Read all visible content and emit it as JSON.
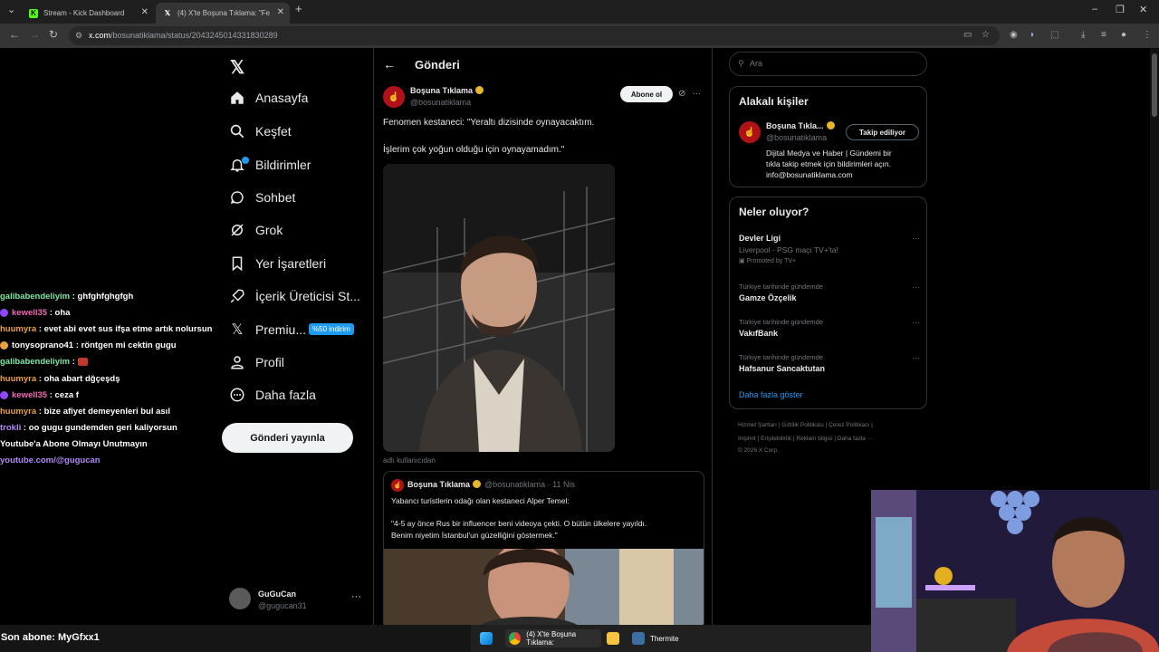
{
  "browser": {
    "tabs": [
      {
        "title": "Stream - Kick Dashboard",
        "active": false
      },
      {
        "title": "(4) X'te Boşuna Tıklama: \"Fe",
        "active": true
      }
    ],
    "new_tab": "+",
    "url_host": "x.com",
    "url_path": "/bosunatiklama/status/2043245014331830289",
    "window_controls": [
      "–",
      "❐",
      "✕"
    ]
  },
  "nav": {
    "items": [
      {
        "label": "Anasayfa",
        "icon": "home-icon"
      },
      {
        "label": "Keşfet",
        "icon": "search-icon"
      },
      {
        "label": "Bildirimler",
        "icon": "bell-icon"
      },
      {
        "label": "Sohbet",
        "icon": "chat-icon"
      },
      {
        "label": "Grok",
        "icon": "grok-icon"
      },
      {
        "label": "Yer İşaretleri",
        "icon": "bookmark-icon"
      },
      {
        "label": "İçerik Üreticisi St...",
        "icon": "rocket-icon"
      },
      {
        "label": "Premiu...",
        "icon": "x-icon"
      },
      {
        "label": "Profil",
        "icon": "user-icon"
      },
      {
        "label": "Daha fazla",
        "icon": "more-circle-icon"
      }
    ],
    "premium_badge": "%50 indirim",
    "post_button": "Gönderi yayınla",
    "account": {
      "name": "GuGuCan",
      "handle": "@gugucan31"
    }
  },
  "post": {
    "header_title": "Gönderi",
    "author_name": "Boşuna Tıklama",
    "author_handle": "@bosunatiklama",
    "subscribe_button": "Abone ol",
    "text_line1": "Fenomen kestaneci: \"Yeraltı dizisinde oynayacaktım.",
    "text_line2": "İşlerim çok yoğun olduğu için oynayamadım.\"",
    "media_caption": "adlı kullanıcıdan",
    "quote": {
      "author_name": "Boşuna Tıklama",
      "handle_date": "@bosunatiklama · 11 Nis",
      "line1": "Yabancı turistlerin odağı olan kestaneci Alper Temel:",
      "line2": "\"4-5 ay önce Rus bir influencer beni videoya çekti. O bütün ülkelere yayıldı.",
      "line3": "Benim niyetim İstanbul'un güzelliğini göstermek.\""
    }
  },
  "sidebar": {
    "search_placeholder": "Ara",
    "related": {
      "title": "Alakalı kişiler",
      "name": "Boşuna Tıkla...",
      "handle": "@bosunatiklama",
      "follow_button": "Takip ediliyor",
      "bio1": "Dijital Medya ve Haber | Gündemi bir",
      "bio2": "tıkla takip etmek için bildirimleri açın.",
      "bio3": "info@bosunatiklama.com"
    },
    "trends": {
      "title": "Neler oluyor?",
      "items": [
        {
          "context": "",
          "name": "Devler Ligi",
          "sub": "Liverpool - PSG maçı TV+'ta!",
          "promo": "Promoted by TV+"
        },
        {
          "context": "Türkiye tarihinde gündemde",
          "name": "Gamze Özçelik",
          "sub": "",
          "promo": ""
        },
        {
          "context": "Türkiye tarihinde gündemde",
          "name": "VakıfBank",
          "sub": "",
          "promo": ""
        },
        {
          "context": "Türkiye tarihinde gündemde",
          "name": "Hafsanur Sancaktutan",
          "sub": "",
          "promo": ""
        }
      ],
      "show_more": "Daha fazla göster"
    },
    "footer_line1": "Hizmet Şartları   |   Gizlilik Politikası   |   Çerez Politikası   |",
    "footer_line2": "Imprint   |   Erişilebilirlik   |   Reklam bilgisi   |   Daha fazla ···",
    "footer_line3": "© 2026 X Corp."
  },
  "chat": {
    "lines": [
      {
        "user": "galibabendeliyim",
        "msg": "ghfghfghgfgh",
        "color": "green",
        "badge": ""
      },
      {
        "user": "kewell35",
        "msg": "oha",
        "color": "pink",
        "badge": "#9146ff"
      },
      {
        "user": "huumyra",
        "msg": "evet abi evet sus ifşa etme artık nolursun",
        "color": "orange",
        "badge": ""
      },
      {
        "user": "tonysoprano41",
        "msg": "röntgen mi cektin gugu",
        "color": "white",
        "badge": "#e8a145"
      },
      {
        "user": "galibabendeliyim",
        "msg": "",
        "color": "green",
        "badge": ""
      },
      {
        "user": "huumyra",
        "msg": "oha abart dğçeşdş",
        "color": "orange",
        "badge": ""
      },
      {
        "user": "kewell35",
        "msg": "ceza f",
        "color": "pink",
        "badge": "#9146ff"
      },
      {
        "user": "huumyra",
        "msg": "bize afiyet demeyenleri bul asıl",
        "color": "orange",
        "badge": ""
      },
      {
        "user": "trokli",
        "msg": "oo gugu gundemden geri kaliyorsun",
        "color": "purple",
        "badge": ""
      }
    ],
    "promo_line1": "Youtube'a Abone Olmayı Unutmayın",
    "promo_line2": "youtube.com/@gugucan",
    "last_sub": "Son abone: MyGfxx1"
  },
  "taskbar": {
    "chrome_label": "(4) X'te Boşuna Tıklama:",
    "thermite_label": "Thermite"
  }
}
